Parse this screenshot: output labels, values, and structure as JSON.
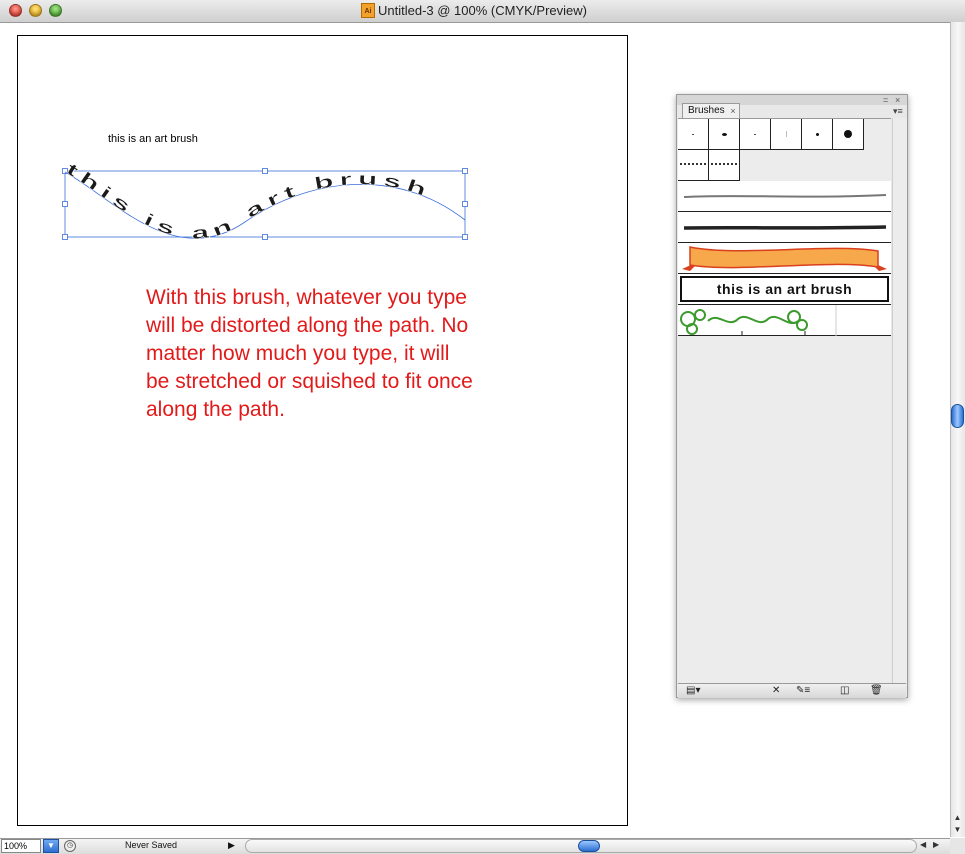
{
  "window": {
    "title": "Untitled-3 @ 100% (CMYK/Preview)",
    "doc_icon_text": "Ai"
  },
  "artboard": {
    "small_label": "this is an art brush",
    "path_text": "this is an art brush",
    "explanation_lines": [
      "With this brush, whatever you type",
      "will be distorted along the path. No",
      "matter how much you type, it will",
      "be stretched or squished to fit once",
      "along the path."
    ],
    "explanation_color": "#e21a1a",
    "selection_color": "#3b6fd8"
  },
  "panel": {
    "tab_label": "Brushes",
    "tab_close": "×",
    "collapse_glyph": "=",
    "close_glyph": "×",
    "menu_glyph": "▾≡",
    "art_brush_label": "this is an art brush",
    "footer_icons": [
      "brush-libraries-icon",
      "remove-stroke-icon",
      "brush-options-icon",
      "new-brush-icon",
      "delete-brush-icon"
    ]
  },
  "statusbar": {
    "zoom": "100%",
    "status": "Never Saved"
  }
}
